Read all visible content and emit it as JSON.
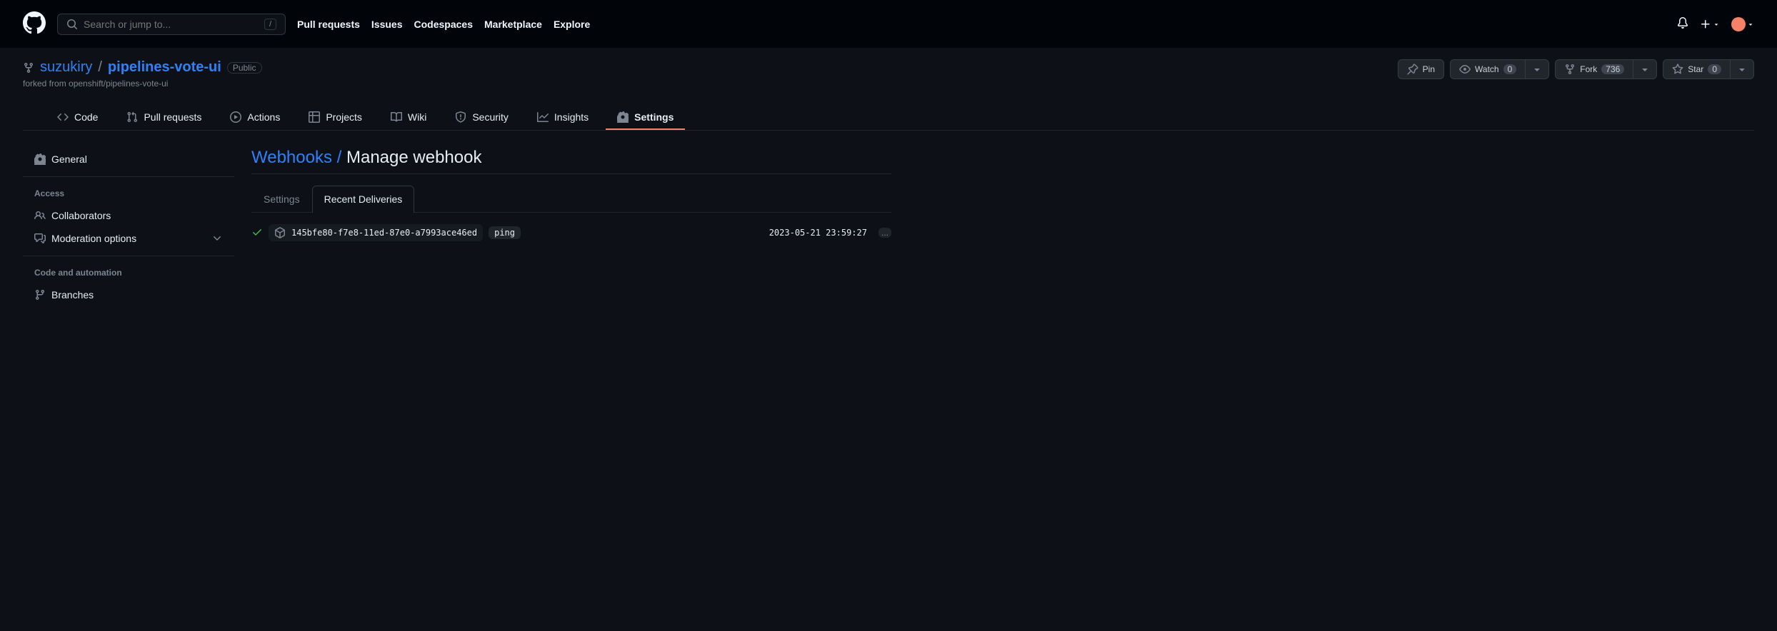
{
  "header": {
    "search_placeholder": "Search or jump to...",
    "search_key": "/",
    "nav": [
      "Pull requests",
      "Issues",
      "Codespaces",
      "Marketplace",
      "Explore"
    ]
  },
  "repo": {
    "owner": "suzukiry",
    "name": "pipelines-vote-ui",
    "visibility": "Public",
    "forked_label": "forked from ",
    "forked_from": "openshift/pipelines-vote-ui",
    "actions": {
      "pin": "Pin",
      "watch": "Watch",
      "watch_count": "0",
      "fork": "Fork",
      "fork_count": "736",
      "star": "Star",
      "star_count": "0"
    },
    "tabs": [
      "Code",
      "Pull requests",
      "Actions",
      "Projects",
      "Wiki",
      "Security",
      "Insights",
      "Settings"
    ]
  },
  "sidebar": {
    "general": "General",
    "access_heading": "Access",
    "collaborators": "Collaborators",
    "moderation": "Moderation options",
    "code_heading": "Code and automation",
    "branches": "Branches"
  },
  "page": {
    "breadcrumb_link": "Webhooks",
    "title": "Manage webhook",
    "tabs": {
      "settings": "Settings",
      "deliveries": "Recent Deliveries"
    },
    "delivery": {
      "id": "145bfe80-f7e8-11ed-87e0-a7993ace46ed",
      "event": "ping",
      "time": "2023-05-21 23:59:27",
      "kebab": "..."
    }
  }
}
